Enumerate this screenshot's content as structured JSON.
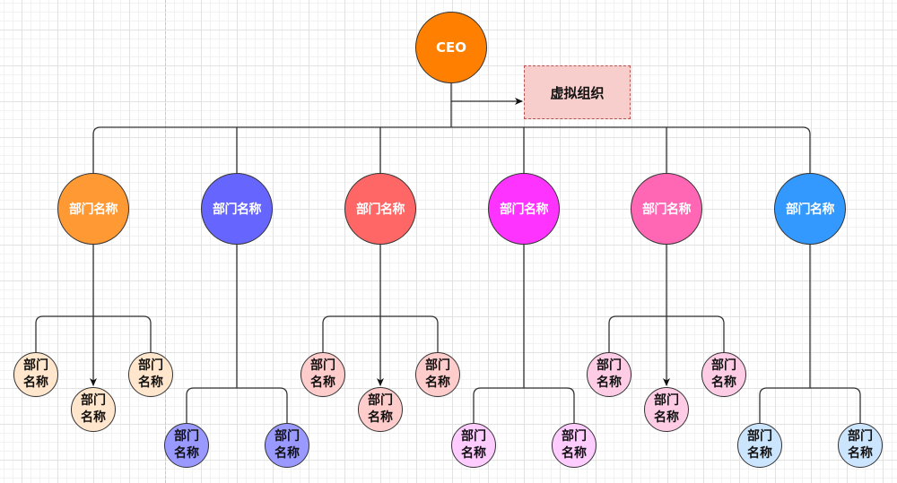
{
  "diagram": {
    "type": "org-chart",
    "root": {
      "label": "CEO",
      "color": "#FF8000"
    },
    "virtual_org": {
      "label": "虚拟组织",
      "fill": "#F8CECC",
      "border": "#B85450"
    },
    "departments": [
      {
        "label": "部门名称",
        "color": "#FF9933",
        "child_color": "#FFE6CC",
        "layout": "three-staggered",
        "children": [
          "部门名称",
          "部门名称",
          "部门名称"
        ]
      },
      {
        "label": "部门名称",
        "color": "#6666FF",
        "child_color": "#9999FF",
        "layout": "two-low",
        "children": [
          "部门名称",
          "部门名称"
        ]
      },
      {
        "label": "部门名称",
        "color": "#FF6666",
        "child_color": "#FFCCCC",
        "layout": "three-staggered",
        "children": [
          "部门名称",
          "部门名称",
          "部门名称"
        ]
      },
      {
        "label": "部门名称",
        "color": "#FF33FF",
        "child_color": "#FFCCFF",
        "layout": "two-low",
        "children": [
          "部门名称",
          "部门名称"
        ]
      },
      {
        "label": "部门名称",
        "color": "#FF66B3",
        "child_color": "#FFCCE6",
        "layout": "three-staggered",
        "children": [
          "部门名称",
          "部门名称",
          "部门名称"
        ]
      },
      {
        "label": "部门名称",
        "color": "#3399FF",
        "child_color": "#CCE5FF",
        "layout": "two-low",
        "children": [
          "部门名称",
          "部门名称"
        ]
      }
    ],
    "line_color": "#333333"
  }
}
